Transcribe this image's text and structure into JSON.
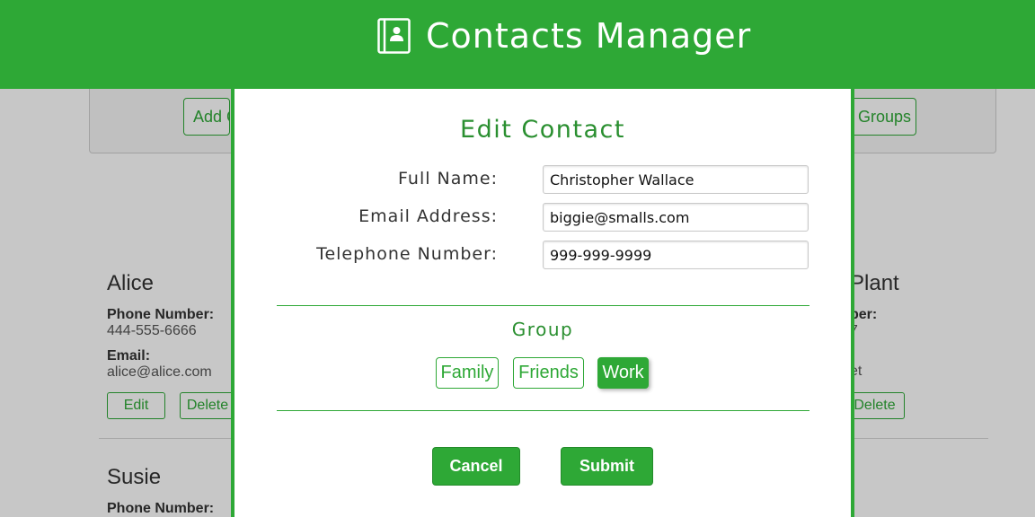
{
  "header": {
    "title": "Contacts Manager",
    "icon": "contacts-book-icon",
    "color": "#2ea836"
  },
  "toolbar": {
    "add_label": "Add C",
    "groups_label": "Groups"
  },
  "contacts_left": [
    {
      "name": "Alice",
      "phone_label": "Phone Number:",
      "phone": "444-555-6666",
      "email_label": "Email:",
      "email": "alice@alice.com",
      "edit_label": "Edit",
      "delete_label": "Delete"
    },
    {
      "name": "Susie",
      "phone_label": "Phone Number:"
    }
  ],
  "contacts_right": {
    "name": "Plant",
    "phone_label": "ber:",
    "phone": "7",
    "email": "et",
    "delete_label": "Delete"
  },
  "modal": {
    "title": "Edit Contact",
    "fields": [
      {
        "label": "Full Name:",
        "value": "Christopher Wallace"
      },
      {
        "label": "Email Address:",
        "value": "biggie@smalls.com"
      },
      {
        "label": "Telephone Number:",
        "value": "999-999-9999"
      }
    ],
    "group_title": "Group",
    "groups": [
      {
        "label": "Family",
        "selected": false
      },
      {
        "label": "Friends",
        "selected": false
      },
      {
        "label": "Work",
        "selected": true
      }
    ],
    "cancel_label": "Cancel",
    "submit_label": "Submit"
  }
}
